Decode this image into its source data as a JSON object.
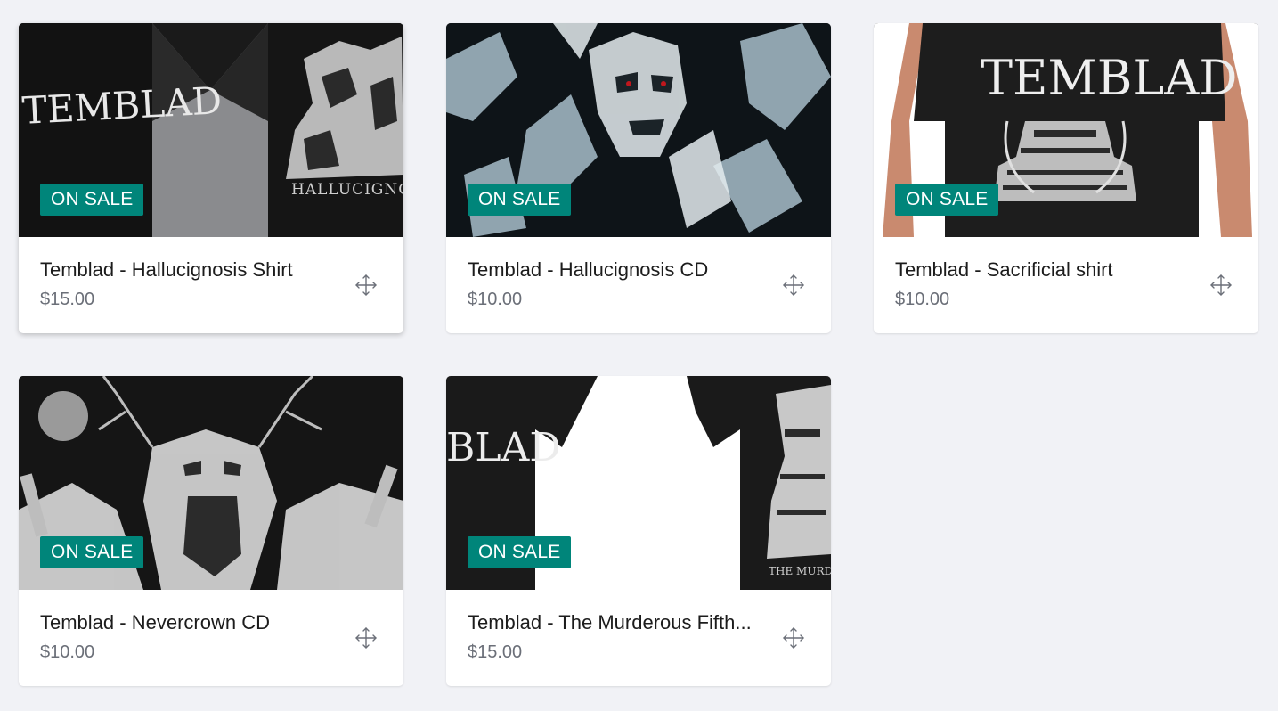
{
  "products": [
    {
      "title": "Temblad - Hallucignosis Shirt",
      "price": "$15.00",
      "badge": "ON SALE",
      "art_logo_text": "TEMBLAD",
      "art_caption": "HALLUCIGNOSIS",
      "move_icon": "move-icon"
    },
    {
      "title": "Temblad - Hallucignosis CD",
      "price": "$10.00",
      "badge": "ON SALE",
      "move_icon": "move-icon"
    },
    {
      "title": "Temblad - Sacrificial shirt",
      "price": "$10.00",
      "badge": "ON SALE",
      "art_logo_text": "TEMBLAD",
      "move_icon": "move-icon"
    },
    {
      "title": "Temblad - Nevercrown CD",
      "price": "$10.00",
      "badge": "ON SALE",
      "move_icon": "move-icon"
    },
    {
      "title": "Temblad - The Murderous Fifth...",
      "price": "$15.00",
      "badge": "ON SALE",
      "art_logo_text": "BLAD",
      "art_caption": "THE MURDE",
      "move_icon": "move-icon"
    }
  ],
  "colors": {
    "background": "#f1f2f6",
    "badge": "#00857a",
    "title": "#1c1c1c",
    "price": "#6b6f78",
    "icon": "#6b6f78"
  }
}
